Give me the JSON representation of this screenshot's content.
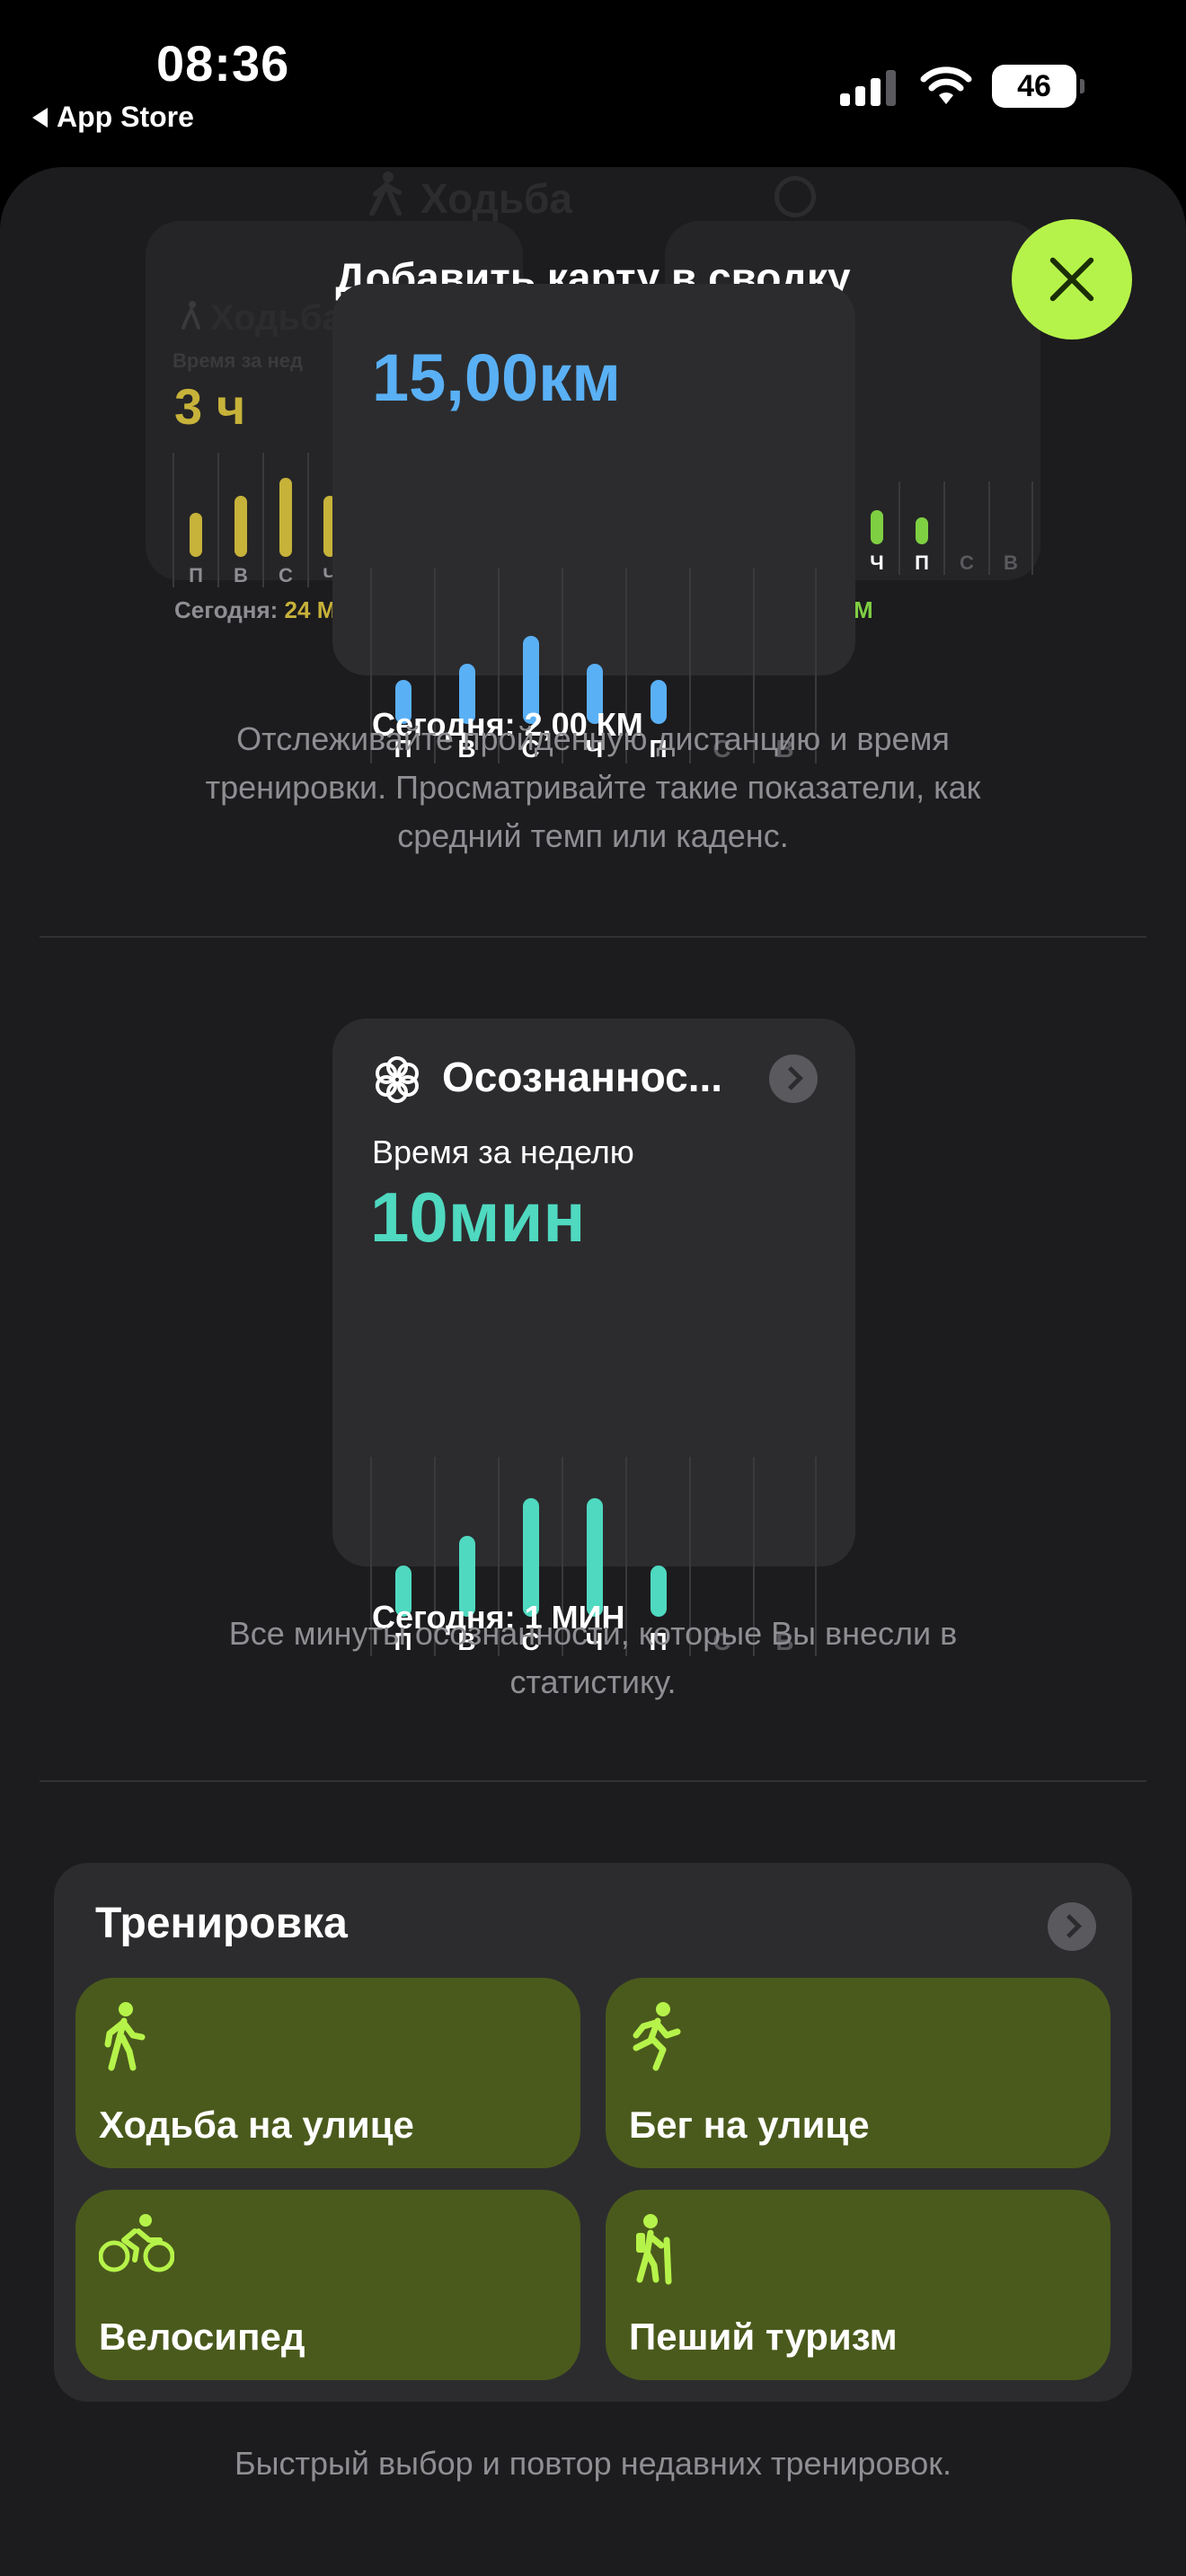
{
  "status_bar": {
    "time": "08:36",
    "back_label": "App Store",
    "battery": "46"
  },
  "sheet": {
    "title": "Добавить карту в сводку",
    "ghost_title": "Ходьба"
  },
  "walking_card": {
    "value": "15,00км",
    "today": "Сегодня: 2,00 КМ",
    "days": [
      "П",
      "В",
      "С",
      "Ч",
      "П",
      "С",
      "В"
    ],
    "values": [
      0.35,
      0.48,
      0.7,
      0.48,
      0.35,
      0,
      0
    ],
    "color": "#5ab0f5"
  },
  "left_back_card": {
    "title": "Ходьба",
    "subtitle": "Время за нед",
    "value": "3 ч",
    "today_prefix": "Сегодня:",
    "today_value": "24 М",
    "days": [
      "П",
      "В",
      "С",
      "Ч"
    ],
    "values": [
      0.38,
      0.52,
      0.68,
      0.52
    ],
    "color": "#c7b23a"
  },
  "right_back_card": {
    "today_value": "М",
    "days": [
      "Ч",
      "П",
      "С",
      "В"
    ],
    "values": [
      0.32,
      0.25,
      0,
      0
    ],
    "color": "#7fcf42"
  },
  "walking_desc": "Отслеживайте пройденную дистанцию и время тренировки. Просматривайте такие показатели, как средний темп или каденс.",
  "mindful_card": {
    "title": "Осознаннос...",
    "subtitle": "Время за неделю",
    "value": "10мин",
    "today": "Сегодня: 1 МИН",
    "days": [
      "П",
      "В",
      "С",
      "Ч",
      "П",
      "С",
      "В"
    ],
    "values": [
      0.38,
      0.6,
      0.88,
      0.88,
      0.38,
      0,
      0
    ],
    "color": "#4fd9c0"
  },
  "mindful_desc": "Все минуты осознанности, которые Вы внесли в статистику.",
  "workout_card": {
    "title": "Тренировка",
    "tiles": [
      {
        "label": "Ходьба на улице",
        "icon": "walking-icon"
      },
      {
        "label": "Бег на улице",
        "icon": "running-icon"
      },
      {
        "label": "Велосипед",
        "icon": "cycling-icon"
      },
      {
        "label": "Пеший туризм",
        "icon": "hiking-icon"
      }
    ],
    "accent": "#b6f34a"
  },
  "workout_desc": "Быстрый выбор и повтор недавних тренировок."
}
